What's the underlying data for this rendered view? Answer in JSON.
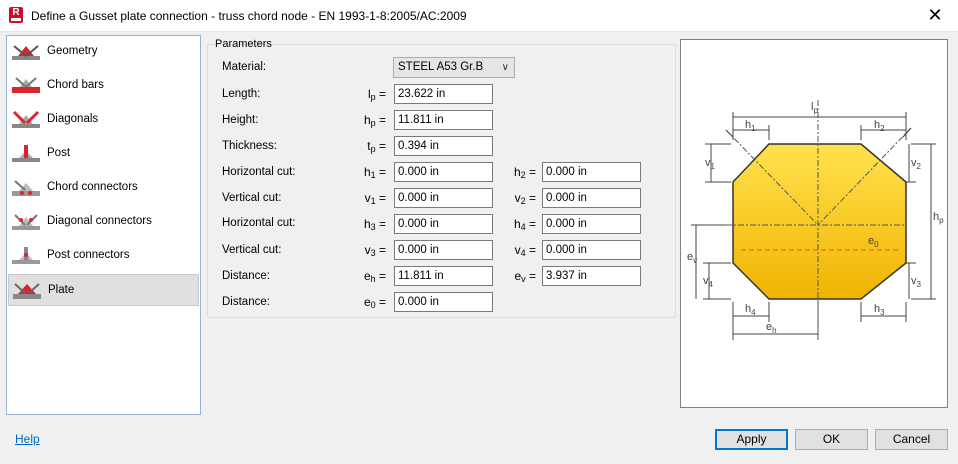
{
  "window": {
    "title": "Define a Gusset plate connection - truss chord node - EN 1993-1-8:2005/AC:2009",
    "app_icon_letter": "R",
    "close_glyph": "✕"
  },
  "nav": {
    "items": [
      {
        "label": "Geometry"
      },
      {
        "label": "Chord bars"
      },
      {
        "label": "Diagonals"
      },
      {
        "label": "Post"
      },
      {
        "label": "Chord connectors"
      },
      {
        "label": "Diagonal connectors"
      },
      {
        "label": "Post connectors"
      },
      {
        "label": "Plate"
      }
    ],
    "selected": "Plate"
  },
  "parameters": {
    "group_label": "Parameters",
    "material": {
      "label": "Material:",
      "value": "STEEL A53 Gr.B"
    },
    "length": {
      "label": "Length:",
      "sym": "l",
      "sub": "p",
      "value": "23.622 in"
    },
    "height": {
      "label": "Height:",
      "sym": "h",
      "sub": "p",
      "value": "11.811 in"
    },
    "thickness": {
      "label": "Thickness:",
      "sym": "t",
      "sub": "p",
      "value": "0.394 in"
    },
    "hcut1": {
      "label": "Horizontal cut:",
      "left": {
        "sym": "h",
        "sub": "1",
        "value": "0.000 in"
      },
      "right": {
        "sym": "h",
        "sub": "2",
        "value": "0.000 in"
      }
    },
    "vcut1": {
      "label": "Vertical cut:",
      "left": {
        "sym": "v",
        "sub": "1",
        "value": "0.000 in"
      },
      "right": {
        "sym": "v",
        "sub": "2",
        "value": "0.000 in"
      }
    },
    "hcut2": {
      "label": "Horizontal cut:",
      "left": {
        "sym": "h",
        "sub": "3",
        "value": "0.000 in"
      },
      "right": {
        "sym": "h",
        "sub": "4",
        "value": "0.000 in"
      }
    },
    "vcut2": {
      "label": "Vertical cut:",
      "left": {
        "sym": "v",
        "sub": "3",
        "value": "0.000 in"
      },
      "right": {
        "sym": "v",
        "sub": "4",
        "value": "0.000 in"
      }
    },
    "distance1": {
      "label": "Distance:",
      "left": {
        "sym": "e",
        "sub": "h",
        "value": "11.811 in"
      },
      "right": {
        "sym": "e",
        "sub": "v",
        "value": "3.937 in"
      }
    },
    "distance2": {
      "label": "Distance:",
      "sym": "e",
      "sub": "0",
      "value": "0.000 in"
    }
  },
  "diagram": {
    "labels": {
      "lp": "l",
      "lp_sub": "p",
      "hp": "h",
      "hp_sub": "p",
      "h1": "h",
      "h1_sub": "1",
      "h2": "h",
      "h2_sub": "2",
      "h3": "h",
      "h3_sub": "3",
      "h4": "h",
      "h4_sub": "4",
      "v1": "v",
      "v1_sub": "1",
      "v2": "v",
      "v2_sub": "2",
      "v3": "v",
      "v3_sub": "3",
      "v4": "v",
      "v4_sub": "4",
      "eh": "e",
      "eh_sub": "h",
      "ev": "e",
      "ev_sub": "v",
      "e0": "e",
      "e0_sub": "0"
    },
    "colors": {
      "plate_top": "#ffe14d",
      "plate_bottom": "#f0b400",
      "outline": "#333333",
      "dim_line": "#444444",
      "axis_line": "#555555",
      "eccentric_line": "#e06020"
    }
  },
  "footer": {
    "help": "Help",
    "apply": "Apply",
    "ok": "OK",
    "cancel": "Cancel"
  },
  "colors": {
    "accent": "#0078d7",
    "link": "#0066cc",
    "brand": "#c8102e"
  }
}
